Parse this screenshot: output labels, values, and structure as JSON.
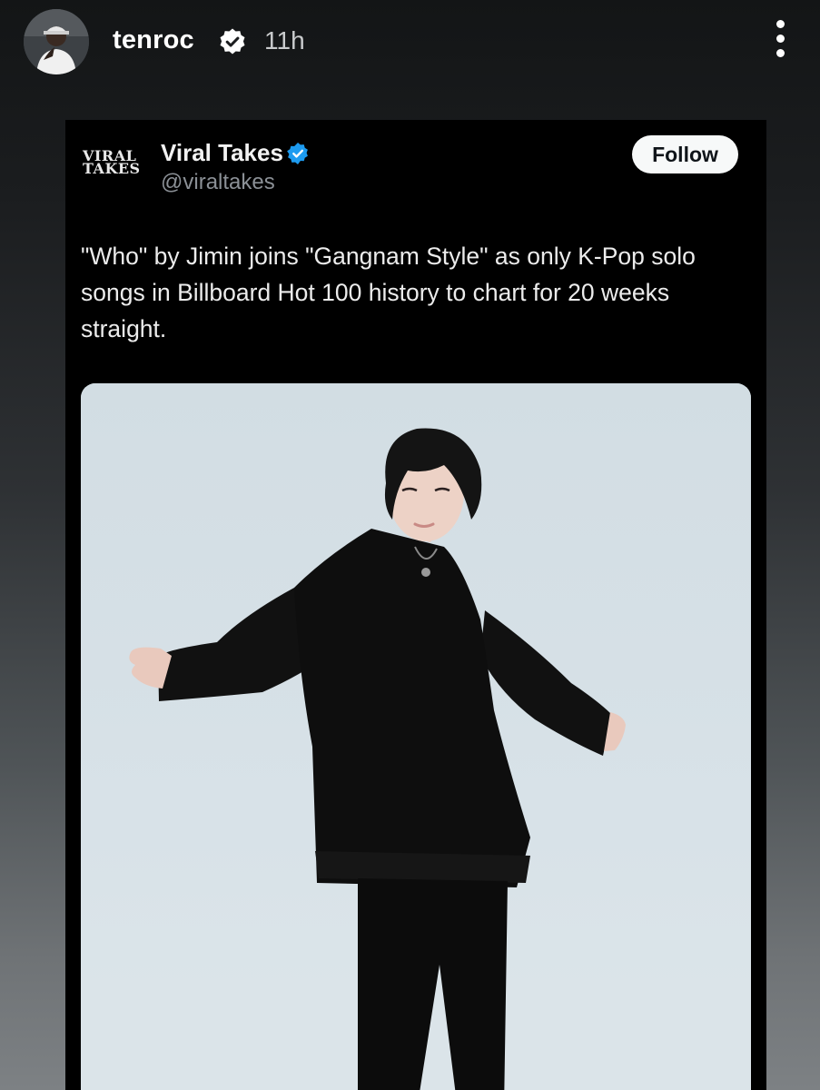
{
  "story": {
    "username": "tenroc",
    "timestamp": "11h",
    "icons": {
      "avatar": "avatar-icon",
      "verified": "verified-badge-icon",
      "more": "more-vertical-icon"
    }
  },
  "tweet": {
    "logo_line1": "VIRAL",
    "logo_line2": "TAKES",
    "display_name": "Viral Takes",
    "handle": "@viraltakes",
    "follow_label": "Follow",
    "text": "\"Who\" by Jimin joins \"Gangnam Style\" as only K-Pop solo songs in Billboard Hot 100 history to chart for 20 weeks straight.",
    "verified_color": "#1d9bf0"
  },
  "colors": {
    "card_background": "#000000",
    "photo_background": "#d5e0e6",
    "follow_button": "#f7f9f9"
  }
}
